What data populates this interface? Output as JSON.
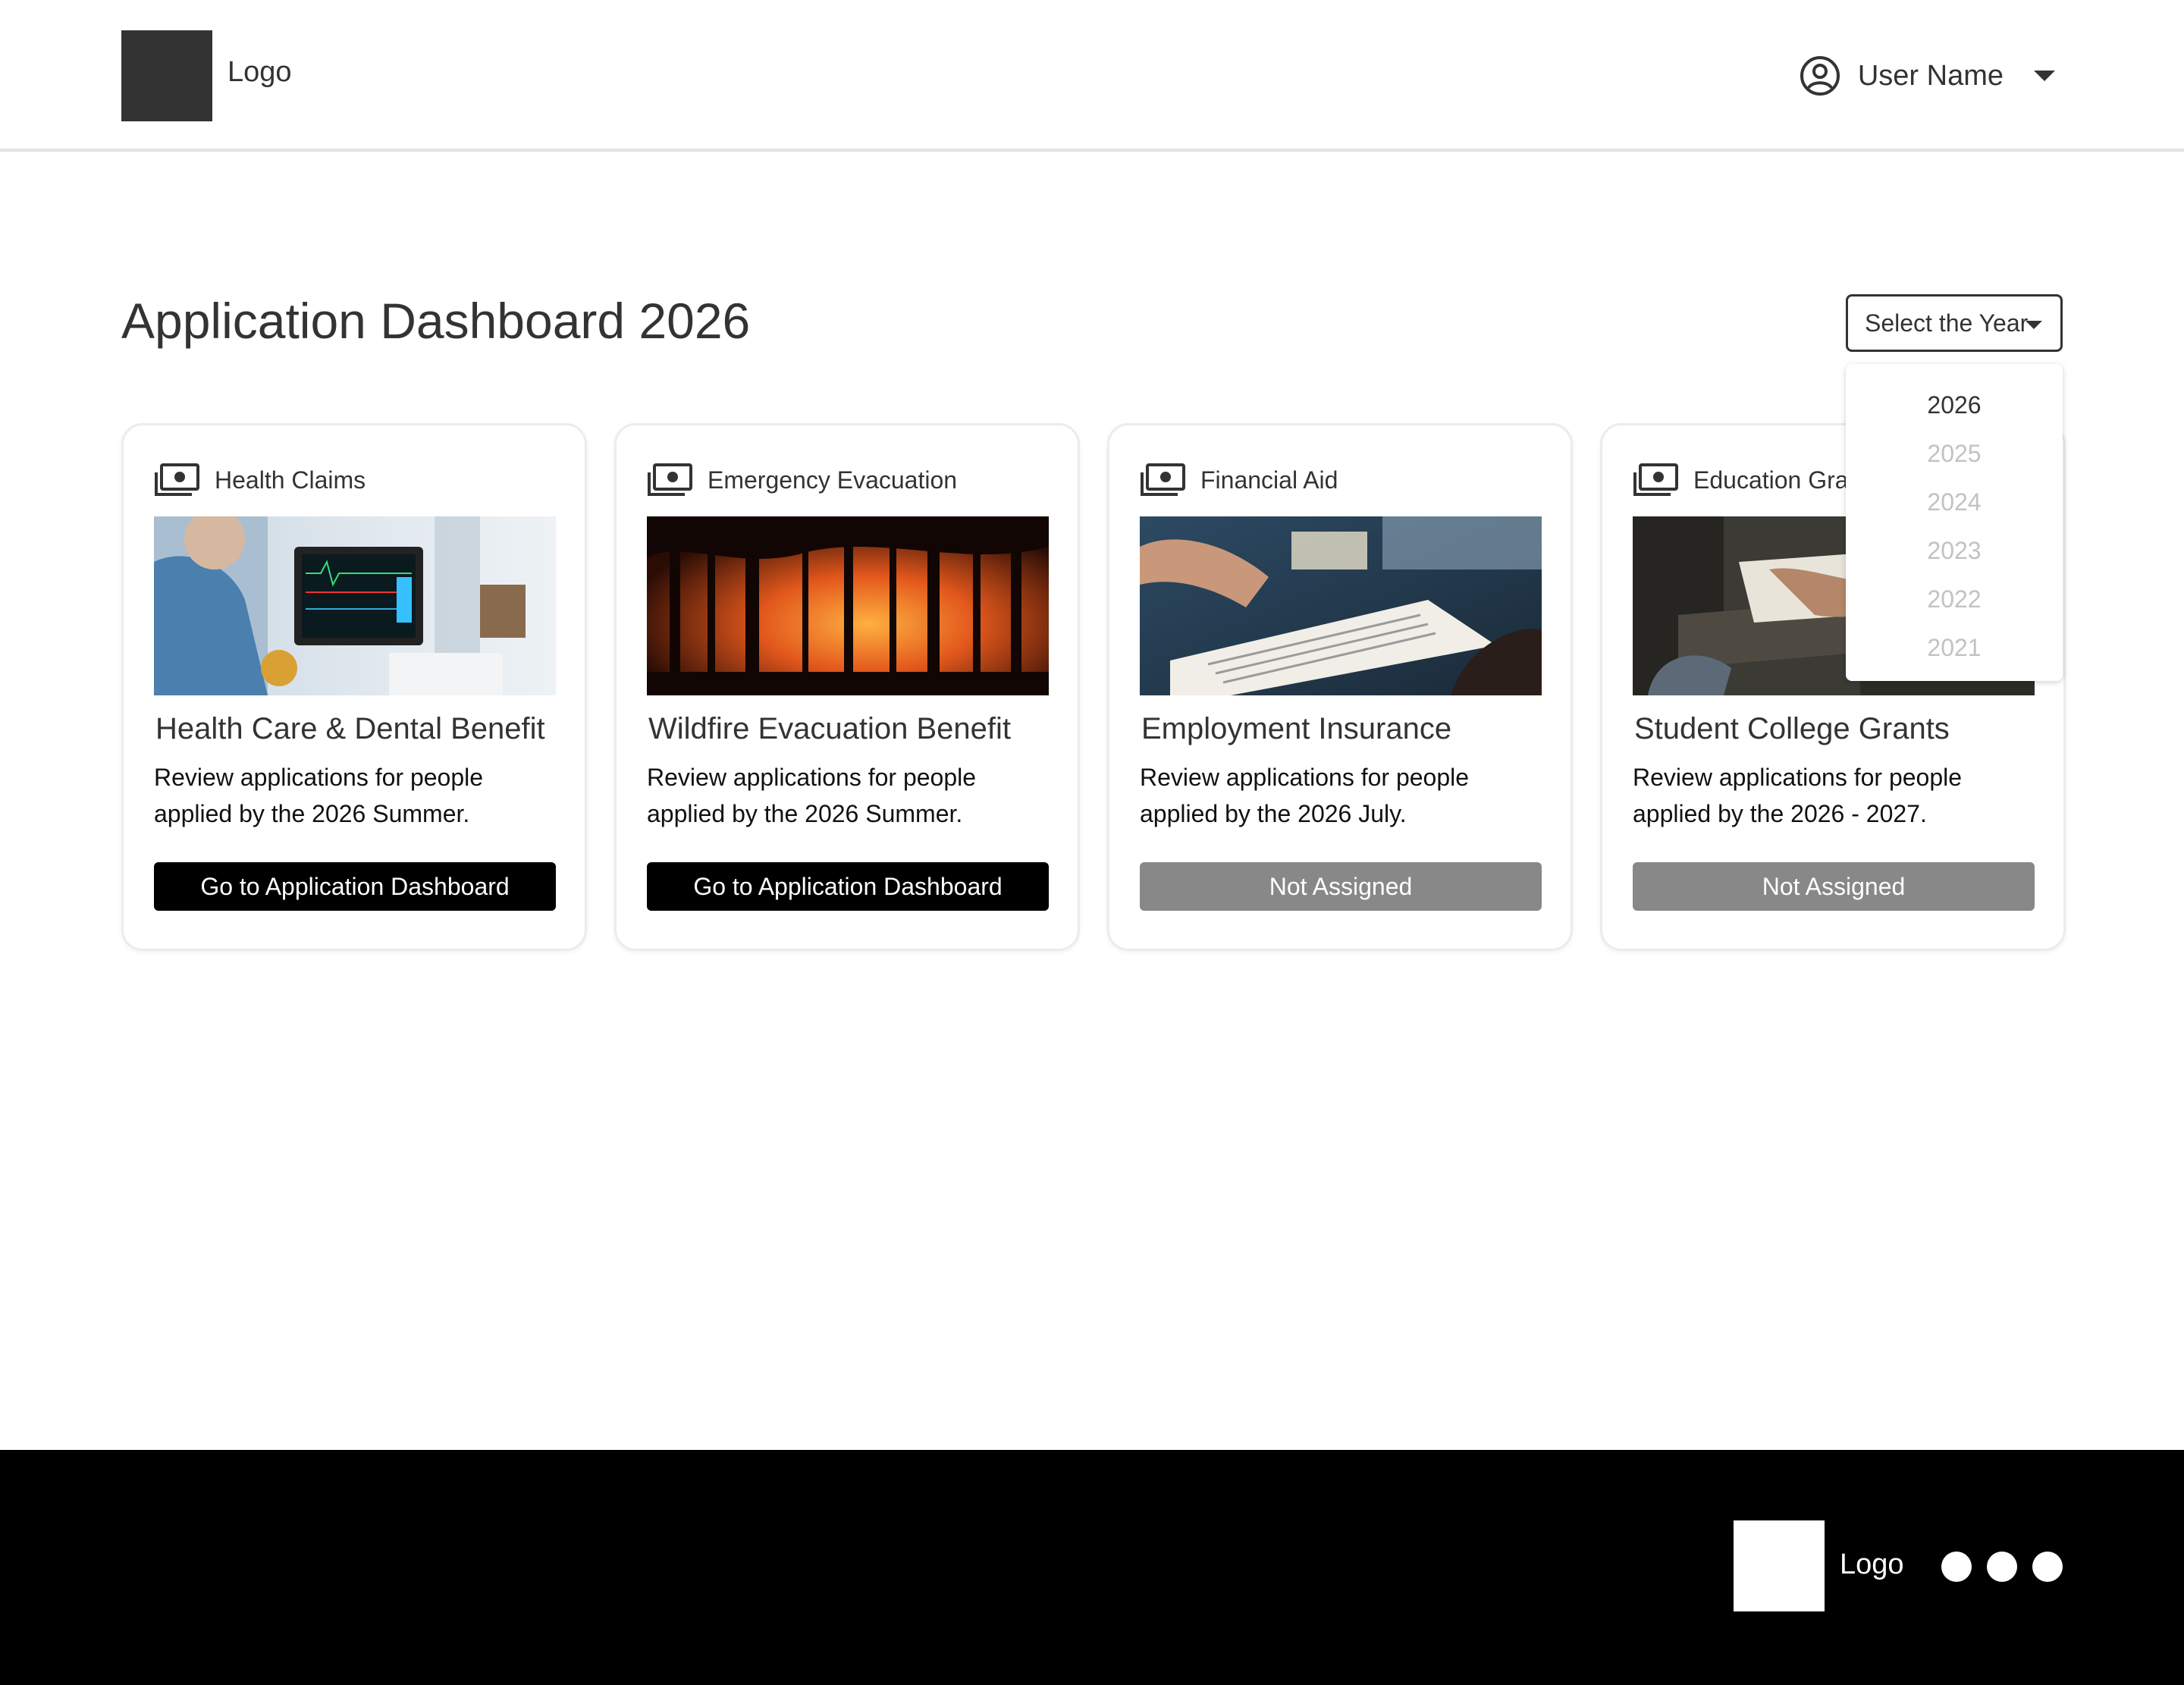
{
  "header": {
    "logo_text": "Logo",
    "user_name": "User Name",
    "user_icon": "user-circle-icon",
    "menu_icon": "caret-down-icon"
  },
  "page": {
    "title": "Application Dashboard 2026"
  },
  "year_select": {
    "label": "Select the Year",
    "options": [
      "2026",
      "2025",
      "2024",
      "2023",
      "2022",
      "2021"
    ],
    "selected": "2026"
  },
  "cards": [
    {
      "category": "Health Claims",
      "category_icon": "money-bills-icon",
      "image": "hospital-monitor-photo",
      "title": "Health Care & Dental Benefit",
      "description": "Review applications for people applied by the 2026 Summer.",
      "button": "Go to Application Dashboard",
      "button_state": "active"
    },
    {
      "category": "Emergency Evacuation",
      "category_icon": "money-bills-icon",
      "image": "forest-wildfire-photo",
      "title": "Wildfire Evacuation Benefit",
      "description": "Review applications for people applied by the 2026 Summer.",
      "button": "Go to Application Dashboard",
      "button_state": "active"
    },
    {
      "category": "Financial Aid",
      "category_icon": "money-bills-icon",
      "image": "paperwork-signing-photo",
      "title": "Employment Insurance",
      "description": "Review applications for people applied by the 2026 July.",
      "button": "Not Assigned",
      "button_state": "disabled"
    },
    {
      "category": "Education Grants",
      "category_icon": "money-bills-icon",
      "image": "student-writing-photo",
      "title": "Student College Grants",
      "description": "Review applications for people applied by the 2026 - 2027.",
      "button": "Not Assigned",
      "button_state": "disabled"
    }
  ],
  "footer": {
    "logo_text": "Logo",
    "social_icons": [
      "social-circle-icon",
      "social-circle-icon",
      "social-circle-icon"
    ]
  },
  "colors": {
    "primary_button": "#000000",
    "disabled_button": "#888888",
    "footer_bg": "#000000",
    "text": "#333333"
  }
}
